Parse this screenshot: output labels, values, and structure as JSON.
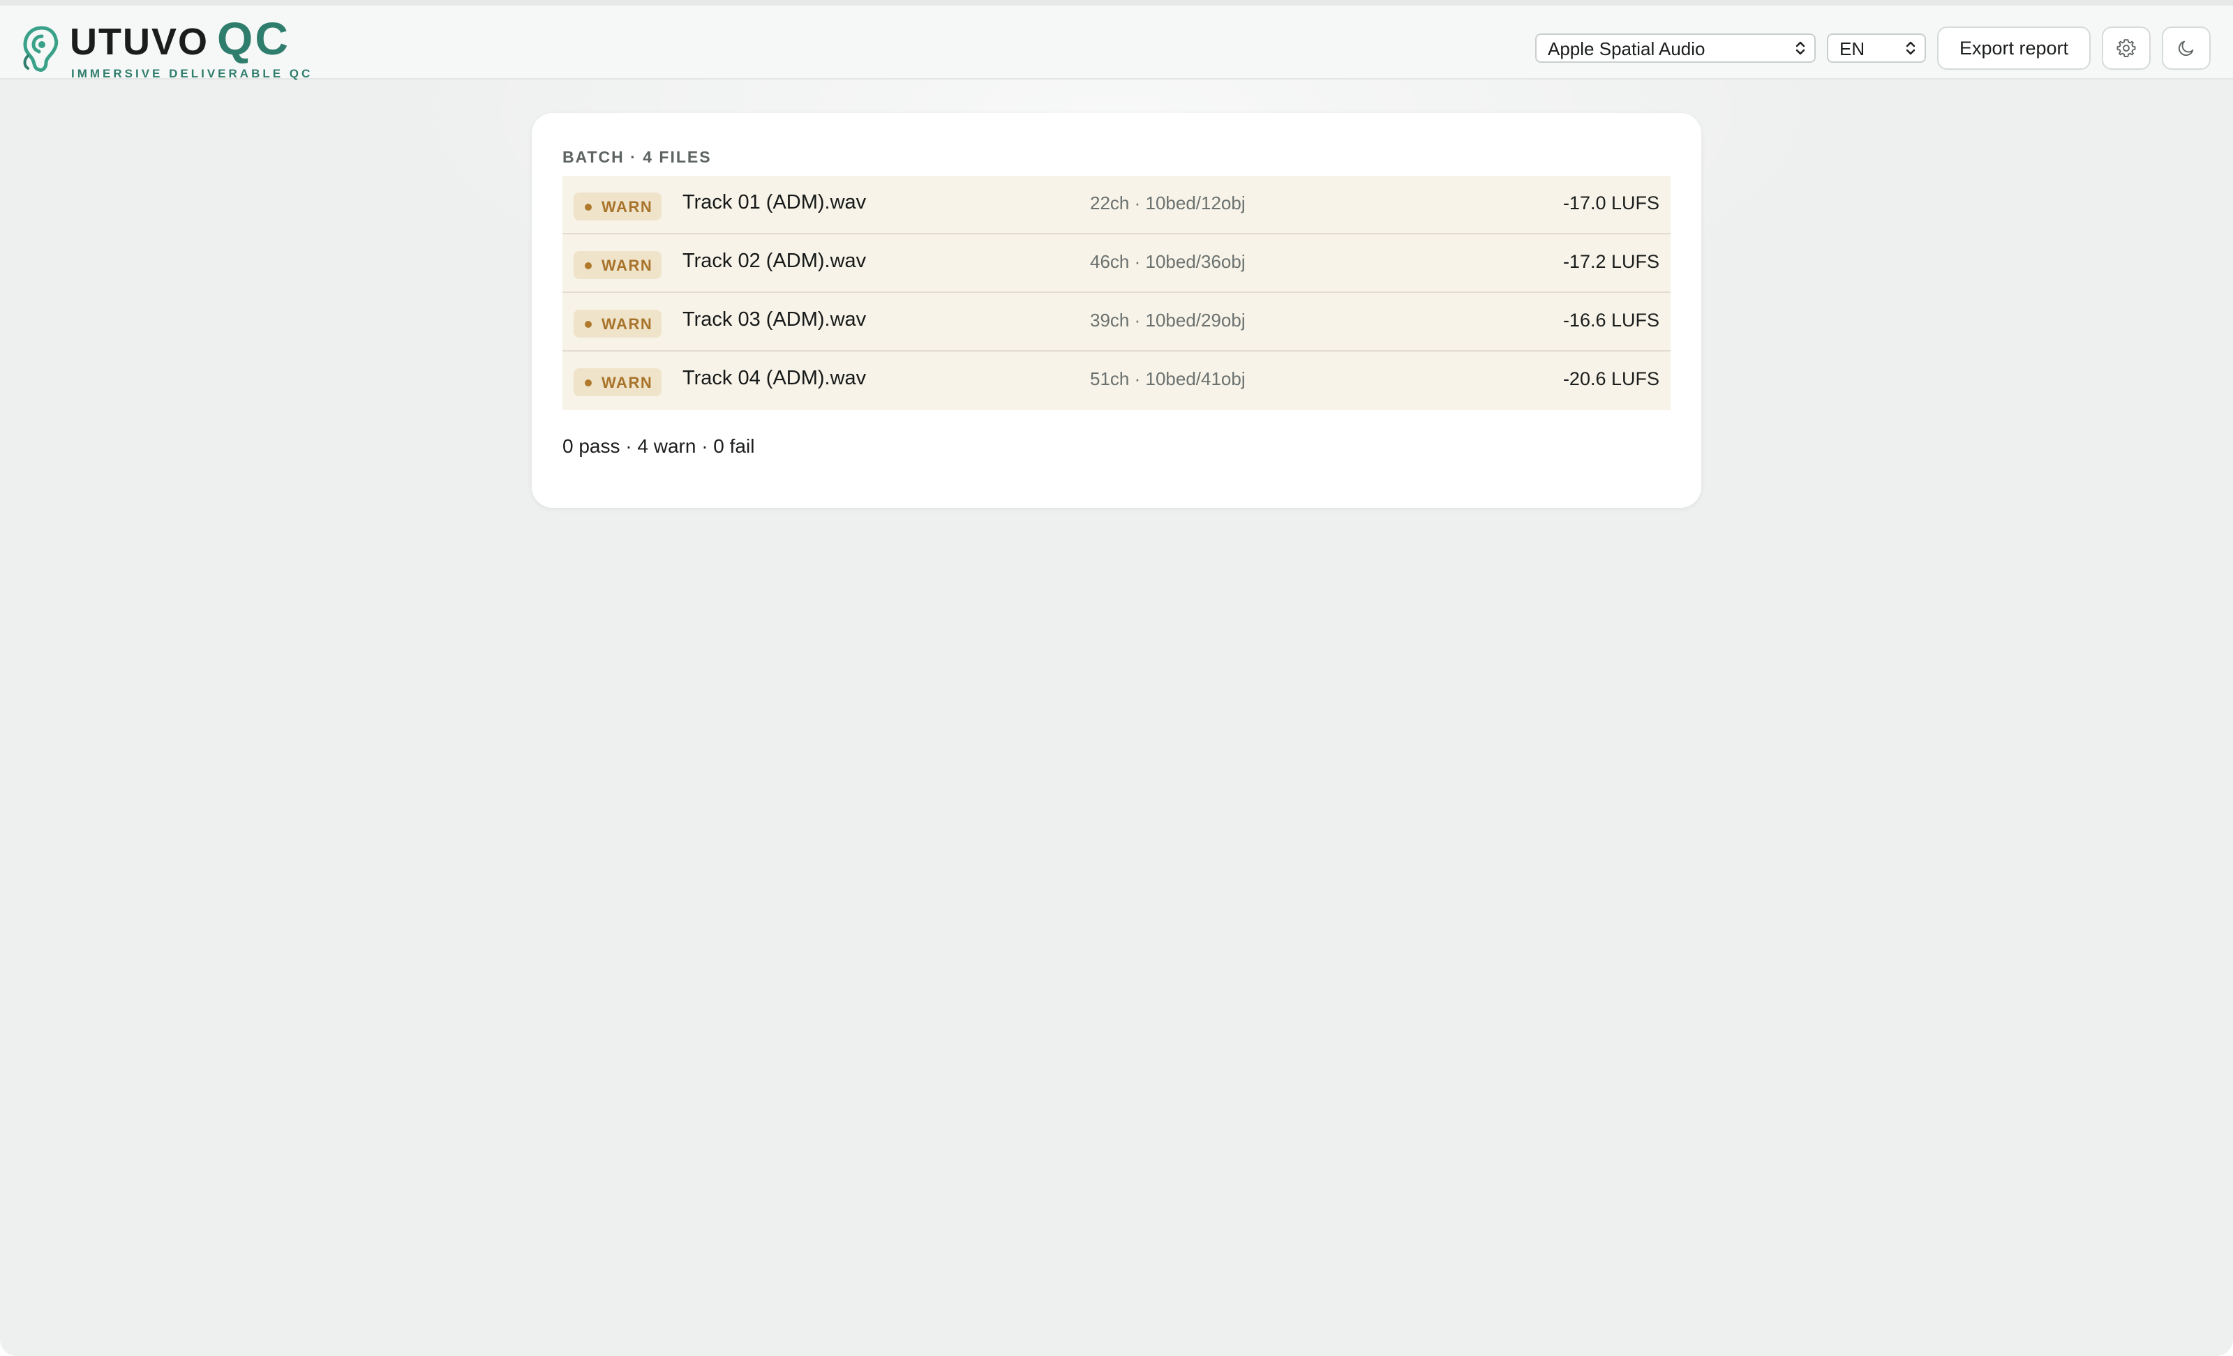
{
  "header": {
    "brand_name": "UTUVO",
    "brand_qc": "QC",
    "brand_subtitle": "IMMERSIVE DELIVERABLE QC",
    "profile_select": {
      "value": "Apple Spatial Audio"
    },
    "language_select": {
      "value": "EN"
    },
    "export_label": "Export report",
    "settings_icon": "gear-icon",
    "theme_icon": "moon-icon"
  },
  "batch": {
    "title": "BATCH · 4 FILES",
    "files": [
      {
        "status": "WARN",
        "name": "Track 01 (ADM).wav",
        "channels": "22ch · 10bed/12obj",
        "loudness": "-17.0 LUFS"
      },
      {
        "status": "WARN",
        "name": "Track 02 (ADM).wav",
        "channels": "46ch · 10bed/36obj",
        "loudness": "-17.2 LUFS"
      },
      {
        "status": "WARN",
        "name": "Track 03 (ADM).wav",
        "channels": "39ch · 10bed/29obj",
        "loudness": "-16.6 LUFS"
      },
      {
        "status": "WARN",
        "name": "Track 04 (ADM).wav",
        "channels": "51ch · 10bed/41obj",
        "loudness": "-20.6 LUFS"
      }
    ],
    "summary": "0 pass · 4 warn · 0 fail"
  },
  "colors": {
    "accent": "#2f7d6c",
    "warn_text": "#a8732a",
    "warn_badge_bg": "#efe3c9",
    "warn_row_bg": "#f7f3e8",
    "page_bg": "#eef0ef"
  }
}
